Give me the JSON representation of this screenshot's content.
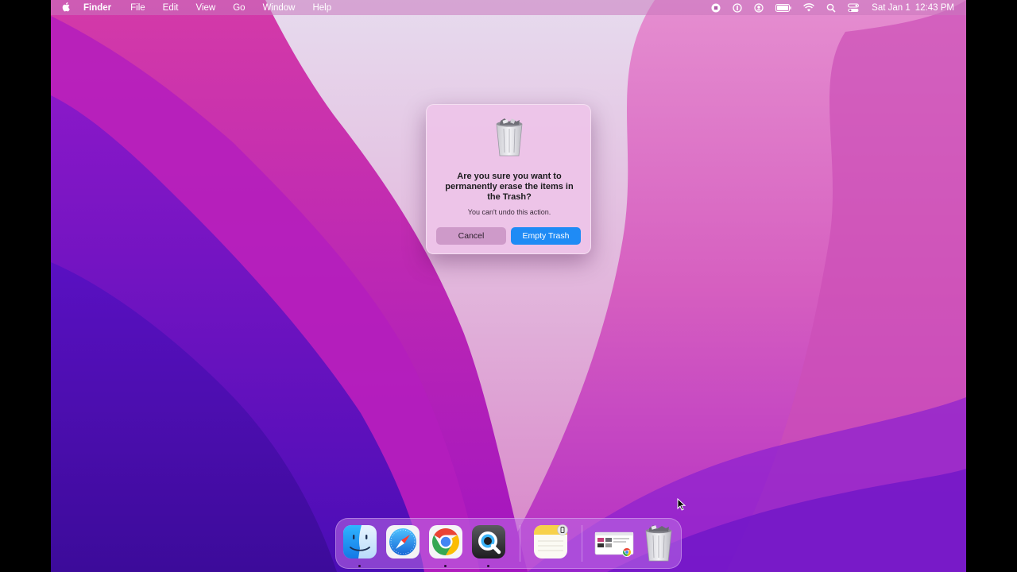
{
  "menubar": {
    "apple_icon": "apple-logo-icon",
    "app_name": "Finder",
    "menus": [
      "File",
      "Edit",
      "View",
      "Go",
      "Window",
      "Help"
    ],
    "status_icons": [
      "screen-record-icon",
      "one-password-icon",
      "user-account-icon",
      "battery-icon",
      "wifi-icon",
      "spotlight-search-icon",
      "control-center-icon"
    ],
    "date": "Sat Jan 1",
    "time": "12:43 PM"
  },
  "dialog": {
    "icon": "trash-full-icon",
    "title": "Are you sure you want to permanently erase the items in the Trash?",
    "message": "You can't undo this action.",
    "cancel_label": "Cancel",
    "confirm_label": "Empty Trash",
    "accent_color": "#1f8bf5"
  },
  "dock": {
    "items": [
      {
        "name": "finder",
        "icon": "finder-icon",
        "running": true
      },
      {
        "name": "safari",
        "icon": "safari-icon",
        "running": false
      },
      {
        "name": "chrome",
        "icon": "chrome-icon",
        "running": true
      },
      {
        "name": "quicktime",
        "icon": "quicktime-icon",
        "running": true
      },
      {
        "name": "notes",
        "icon": "notes-icon",
        "running": false
      },
      {
        "name": "downloads-stack",
        "icon": "downloads-stack-icon",
        "running": false
      },
      {
        "name": "trash",
        "icon": "trash-full-icon",
        "running": false
      }
    ]
  }
}
